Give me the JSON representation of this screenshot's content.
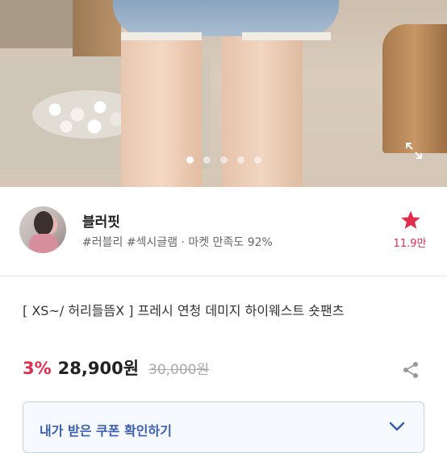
{
  "gallery": {
    "slide_count": 5,
    "active_index": 0,
    "expand_icon": "expand-icon"
  },
  "seller": {
    "name": "블러핏",
    "tags": "#러블리 #섹시글램 · 마켓 만족도 92%",
    "likes": "11.9만",
    "star_icon": "star-icon",
    "accent": "#e02e4e"
  },
  "product": {
    "title": "[ XS~/ 허리들뜸X ] 프레시 연청 데미지 하이웨스트 숏팬츠",
    "discount": "3%",
    "price": "28,900원",
    "original_price": "30,000원",
    "share_icon": "share-icon"
  },
  "coupon": {
    "label": "내가 받은 쿠폰 확인하기",
    "chevron_icon": "chevron-down-icon",
    "color": "#3b5fb0"
  }
}
